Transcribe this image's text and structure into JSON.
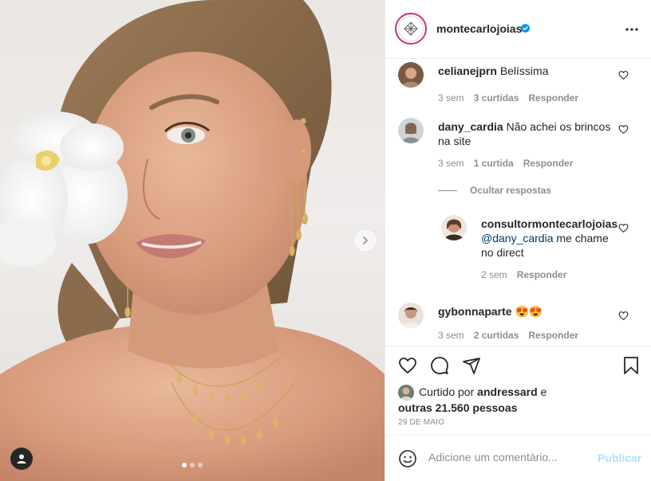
{
  "post": {
    "username": "montecarlojoias",
    "verified": true,
    "carousel_total": 3,
    "carousel_active": 1
  },
  "comments": [
    {
      "username": "celianejprn",
      "text": "Belíssima",
      "age": "3 sem",
      "likes": "3 curtidas",
      "reply": "Responder"
    },
    {
      "username": "dany_cardia",
      "text": "Não achei os brincos na site",
      "age": "3 sem",
      "likes": "1 curtida",
      "reply": "Responder"
    },
    {
      "username": "gybonnaparte",
      "text": "😍😍",
      "age": "3 sem",
      "likes": "2 curtidas",
      "reply": "Responder"
    }
  ],
  "hide_replies_label": "Ocultar respostas",
  "reply": {
    "username": "consultormontecarlojoias",
    "mention": "@dany_cardia",
    "text": "me chame no direct",
    "age": "2 sem",
    "reply": "Responder"
  },
  "likes": {
    "prefix": "Curtido por",
    "user": "andressard",
    "conj": "e",
    "others": "outras 21.560 pessoas"
  },
  "date": "29 DE MAIO",
  "add_comment": {
    "placeholder": "Adicione um comentário...",
    "publish": "Publicar"
  },
  "colors": {
    "link": "#00376b",
    "muted": "#8e8e8e",
    "publish_disabled": "#b2dffc",
    "verified": "#0095f6",
    "story_ring": "#c13584"
  },
  "icons": [
    "verified-badge-icon",
    "more-options-icon",
    "heart-icon",
    "comment-icon",
    "share-icon",
    "bookmark-icon",
    "emoji-icon",
    "user-tag-icon",
    "chevron-right-icon"
  ]
}
